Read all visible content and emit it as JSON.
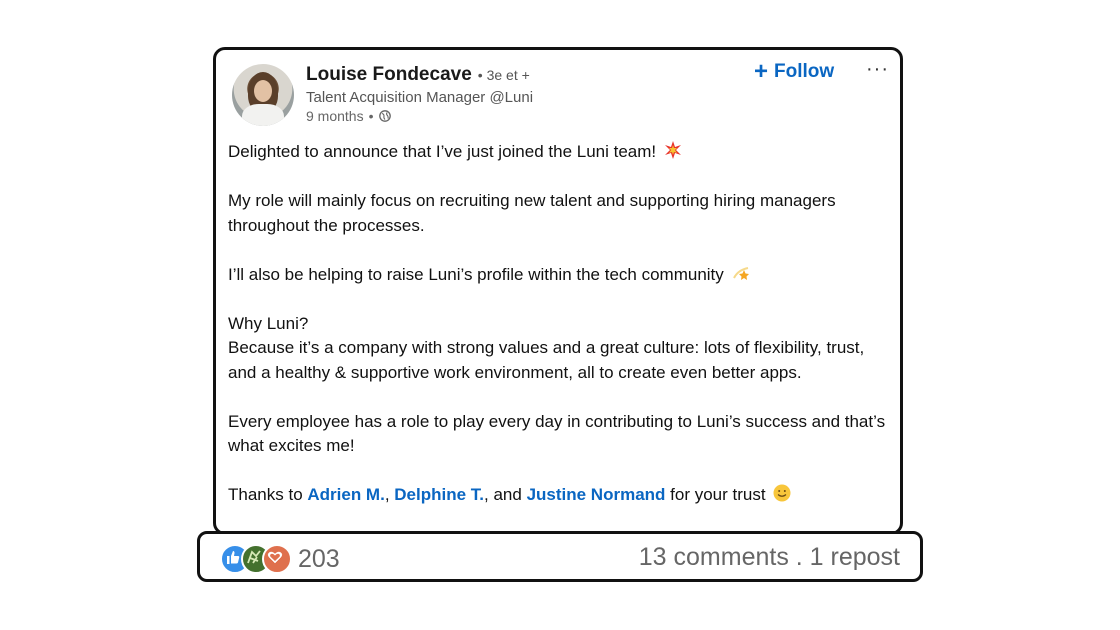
{
  "author": {
    "name": "Louise Fondecave",
    "degree": "• 3e et +",
    "headline": "Talent Acquisition Manager @Luni",
    "time": "9  months",
    "separator": "•"
  },
  "actions": {
    "follow_label": "Follow",
    "more_label": "···"
  },
  "post": {
    "line1": "Delighted to announce that I’ve just joined the Luni team!",
    "line2": "My role will mainly focus on recruiting new talent and supporting hiring managers throughout the processes.",
    "line3": "I’ll also be helping to raise Luni’s profile within the tech community",
    "line4a": "Why Luni?",
    "line4b": "Because it’s a company with strong values and a great culture: lots of flexibility, trust, and a healthy & supportive work environment, all to create even better apps.",
    "line5": "Every employee has a role to play every day in contributing to Luni’s success and that’s what excites me!",
    "thanks_prefix": "Thanks to ",
    "mention1": "Adrien M.",
    "sep1": ", ",
    "mention2": "Delphine T.",
    "sep2": ", and ",
    "mention3": "Justine Normand",
    "thanks_suffix": " for your trust"
  },
  "stats": {
    "reaction_count": "203",
    "comments_reposts": "13 comments . 1 repost"
  },
  "colors": {
    "accent": "#0a66c2",
    "like": "#378fe9",
    "celebrate": "#44712e",
    "love": "#df704d"
  },
  "icons": [
    "globe-icon",
    "plus-icon",
    "more-icon",
    "collision-emoji-icon",
    "dizzy-emoji-icon",
    "smile-emoji-icon",
    "like-icon",
    "celebrate-icon",
    "love-icon"
  ]
}
